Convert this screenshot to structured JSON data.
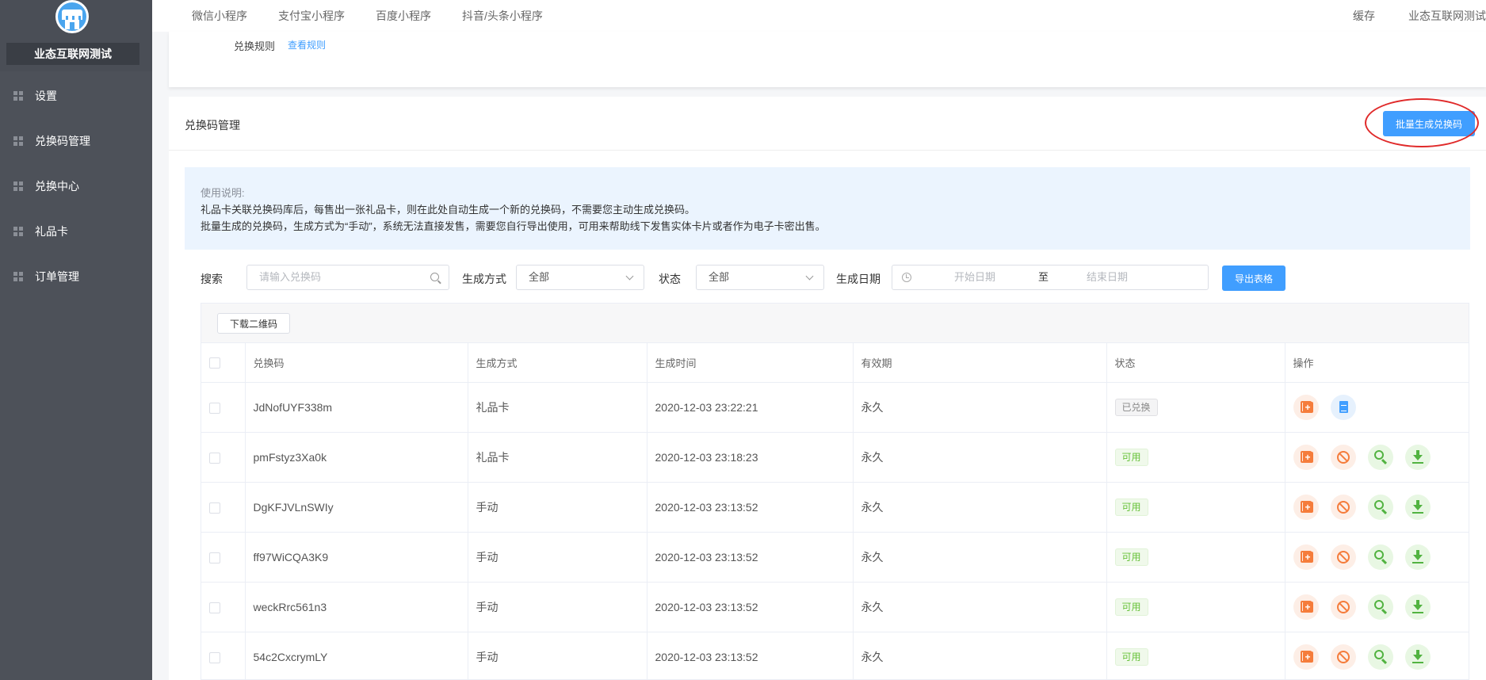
{
  "sidebar": {
    "store_name": "业态互联网测试",
    "items": [
      {
        "label": "设置"
      },
      {
        "label": "兑换码管理"
      },
      {
        "label": "兑换中心"
      },
      {
        "label": "礼品卡"
      },
      {
        "label": "订单管理"
      }
    ]
  },
  "topnav": {
    "tabs": [
      {
        "label": "微信小程序"
      },
      {
        "label": "支付宝小程序"
      },
      {
        "label": "百度小程序"
      },
      {
        "label": "抖音/头条小程序"
      }
    ],
    "right": {
      "cache": "缓存",
      "account": "业态互联网测试"
    }
  },
  "upper": {
    "rule_label": "兑换规则",
    "rule_link": "查看规则"
  },
  "main": {
    "title": "兑换码管理",
    "batch_button": "批量生成兑换码",
    "notice": {
      "title": "使用说明:",
      "line1": "礼品卡关联兑换码库后，每售出一张礼品卡，则在此处自动生成一个新的兑换码，不需要您主动生成兑换码。",
      "line2": "批量生成的兑换码，生成方式为“手动”，系统无法直接发售，需要您自行导出使用，可用来帮助线下发售实体卡片或者作为电子卡密出售。"
    },
    "filter": {
      "search_label": "搜索",
      "search_placeholder": "请输入兑换码",
      "method_label": "生成方式",
      "method_value": "全部",
      "status_label": "状态",
      "status_value": "全部",
      "date_label": "生成日期",
      "start_placeholder": "开始日期",
      "date_sep": "至",
      "end_placeholder": "结束日期",
      "export_button": "导出表格"
    },
    "qr_button": "下载二维码",
    "table": {
      "headers": [
        "兑换码",
        "生成方式",
        "生成时间",
        "有效期",
        "状态",
        "操作"
      ],
      "rows": [
        {
          "code": "JdNofUYF338m",
          "method": "礼品卡",
          "time": "2020-12-03 23:22:21",
          "validity": "永久",
          "status": "已兑换",
          "ops": [
            "copy",
            "doc"
          ]
        },
        {
          "code": "pmFstyz3Xa0k",
          "method": "礼品卡",
          "time": "2020-12-03 23:18:23",
          "validity": "永久",
          "status": "可用",
          "ops": [
            "copy",
            "ban",
            "view",
            "dl"
          ]
        },
        {
          "code": "DgKFJVLnSWIy",
          "method": "手动",
          "time": "2020-12-03 23:13:52",
          "validity": "永久",
          "status": "可用",
          "ops": [
            "copy",
            "ban",
            "view",
            "dl"
          ]
        },
        {
          "code": "ff97WiCQA3K9",
          "method": "手动",
          "time": "2020-12-03 23:13:52",
          "validity": "永久",
          "status": "可用",
          "ops": [
            "copy",
            "ban",
            "view",
            "dl"
          ]
        },
        {
          "code": "weckRrc561n3",
          "method": "手动",
          "time": "2020-12-03 23:13:52",
          "validity": "永久",
          "status": "可用",
          "ops": [
            "copy",
            "ban",
            "view",
            "dl"
          ]
        },
        {
          "code": "54c2CxcrymLY",
          "method": "手动",
          "time": "2020-12-03 23:13:52",
          "validity": "永久",
          "status": "可用",
          "ops": [
            "copy",
            "ban",
            "view",
            "dl"
          ]
        }
      ]
    }
  },
  "icons": {
    "copy": "copy-add-icon",
    "doc": "document-icon",
    "ban": "disable-icon",
    "view": "search-view-icon",
    "dl": "download-icon"
  },
  "colors": {
    "primary": "#409eff",
    "sidebar": "#4d5159",
    "success": "#67c23a",
    "warning": "#f57c3b",
    "annotation": "#e02a2a"
  }
}
